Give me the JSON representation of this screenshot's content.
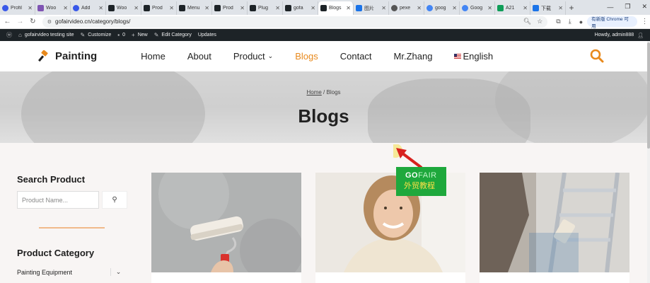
{
  "browser": {
    "tabs": [
      {
        "label": "Profil",
        "color": "#3858e9"
      },
      {
        "label": "Woo",
        "color": "#7f54b3"
      },
      {
        "label": "Add",
        "color": "#3858e9"
      },
      {
        "label": "Woo",
        "color": "#1d2327"
      },
      {
        "label": "Prod",
        "color": "#1d2327"
      },
      {
        "label": "Menu",
        "color": "#1d2327"
      },
      {
        "label": "Prod",
        "color": "#1d2327"
      },
      {
        "label": "Plug",
        "color": "#1d2327"
      },
      {
        "label": "gofa",
        "color": "#1d2327"
      },
      {
        "label": "Blogs",
        "color": "#1d2327",
        "active": true
      },
      {
        "label": "图片",
        "color": "#1a73e8"
      },
      {
        "label": "pexe",
        "color": "#555555"
      },
      {
        "label": "goog",
        "color": "#4285f4"
      },
      {
        "label": "Goog",
        "color": "#4285f4"
      },
      {
        "label": "A21",
        "color": "#0f9d58"
      },
      {
        "label": "下载",
        "color": "#1a73e8"
      }
    ],
    "new_tab": "+",
    "url": "gofairvideo.cn/category/blogs/",
    "chrome_update": "有新版 Chrome 可用"
  },
  "admin_bar": {
    "site": "gofairvideo testing site",
    "customize": "Customize",
    "comments": "0",
    "new": "New",
    "edit": "Edit Category",
    "updates": "Updates",
    "howdy": "Howdy, admin888"
  },
  "header": {
    "logo": "Painting",
    "nav": [
      "Home",
      "About",
      "Product",
      "Blogs",
      "Contact",
      "Mr.Zhang",
      "English"
    ],
    "active": "Blogs",
    "accent": "#e8891c"
  },
  "hero": {
    "crumb_home": "Home",
    "crumb_sep": " / ",
    "crumb_current": "Blogs",
    "title": "Blogs"
  },
  "sidebar": {
    "search_title": "Search Product",
    "search_placeholder": "Product Name...",
    "category_title": "Product Category",
    "categories": [
      "Painting Equipment"
    ]
  },
  "watermark": {
    "go": "GO",
    "fair": "FAIR",
    "cn": "外贸教程"
  }
}
